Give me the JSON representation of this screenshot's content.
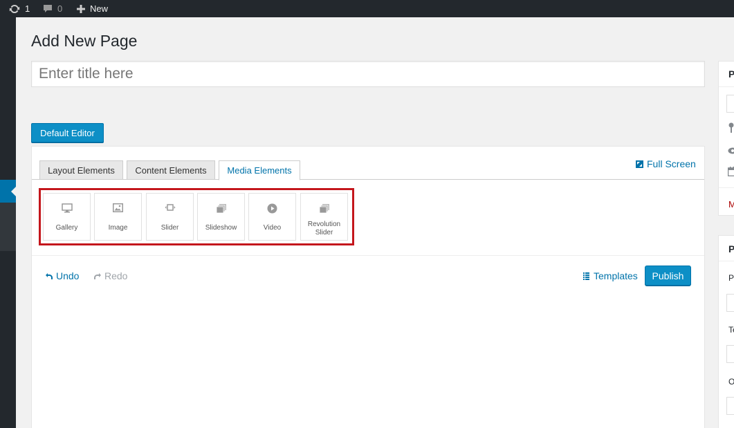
{
  "adminbar": {
    "updates_count": "1",
    "comments_count": "0",
    "new_label": "New"
  },
  "page": {
    "title": "Add New Page",
    "title_placeholder": "Enter title here",
    "default_editor_label": "Default Editor"
  },
  "builder": {
    "tabs": [
      {
        "label": "Layout Elements",
        "active": false
      },
      {
        "label": "Content Elements",
        "active": false
      },
      {
        "label": "Media Elements",
        "active": true
      }
    ],
    "fullscreen_label": "Full Screen",
    "media_elements": [
      {
        "label": "Gallery",
        "icon": "desktop-icon"
      },
      {
        "label": "Image",
        "icon": "image-icon"
      },
      {
        "label": "Slider",
        "icon": "slider-icon"
      },
      {
        "label": "Slideshow",
        "icon": "slideshow-icon"
      },
      {
        "label": "Video",
        "icon": "video-icon"
      },
      {
        "label": "Revolution Slider",
        "icon": "revolution-slider-icon"
      }
    ],
    "undo_label": "Undo",
    "redo_label": "Redo",
    "templates_label": "Templates",
    "publish_label": "Publish"
  },
  "sidebar": {
    "box1_heading": "P",
    "box1_link": "M",
    "box2_heading": "P",
    "box2_label1": "Pa",
    "box2_label2": "Te",
    "box2_label3": "O"
  },
  "colors": {
    "accent": "#0073aa",
    "button": "#0d8fc6",
    "highlight": "#c4161c",
    "adminbar": "#23282d"
  }
}
